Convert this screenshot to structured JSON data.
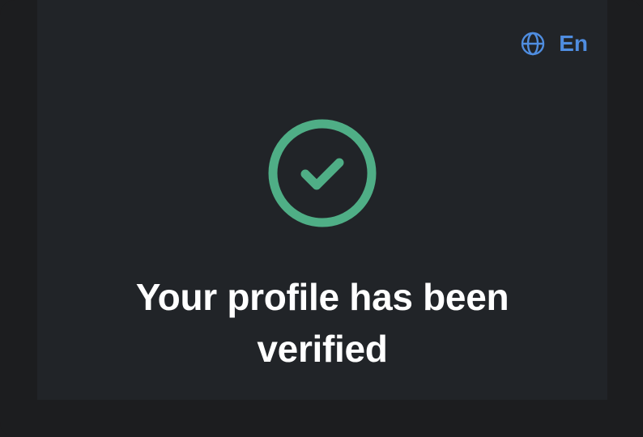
{
  "language": {
    "icon": "globe-icon",
    "label": "En",
    "color": "#4f8de0"
  },
  "status": {
    "icon": "check-circle-icon",
    "color": "#4fae86",
    "message_line1": "Your profile has been",
    "message_line2": "verified"
  },
  "colors": {
    "background": "#1c1d1f",
    "panel": "#212428",
    "text": "#ffffff"
  }
}
